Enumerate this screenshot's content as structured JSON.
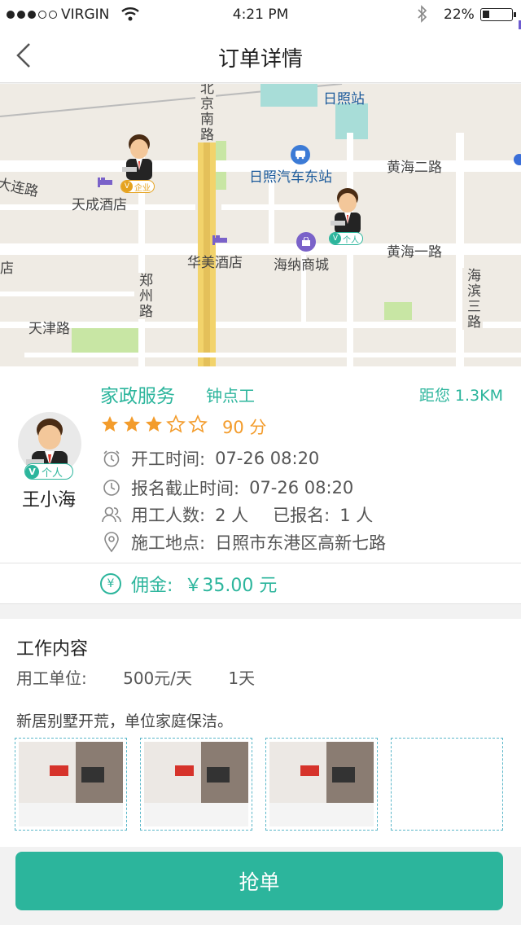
{
  "status_bar": {
    "carrier": "VIRGIN",
    "time": "4:21 PM",
    "battery": "22%",
    "battery_level": 0.22
  },
  "nav": {
    "title": "订单详情",
    "back_icon": "chevron-left-icon"
  },
  "map": {
    "labels": {
      "rizhao_station": "日照站",
      "bus_station": "日照汽车东站",
      "tiancheng_hotel": "天成酒店",
      "huamei_hotel": "华美酒店",
      "haina_mall": "海纳商城",
      "beijing_s_road": "北京南路",
      "huanghai2_road": "黄海二路",
      "huanghai1_road": "黄海一路",
      "dalian_road": "大连路",
      "zhengzhou_road": "郑州路",
      "tianjin_road": "天津路",
      "haibin3_road": "海滨三路",
      "left_fragment": "店"
    },
    "markers": [
      {
        "badge": "企业"
      },
      {
        "badge": "个人"
      }
    ]
  },
  "order": {
    "service": "家政服务",
    "job_type": "钟点工",
    "distance": "距您 1.3KM",
    "rating_stars": 3,
    "rating_max": 5,
    "score": "90 分",
    "worker": {
      "name": "王小海",
      "badge_v": "V",
      "badge_text": "个人"
    },
    "start_time_label": "开工时间:",
    "start_time": "07-26  08:20",
    "deadline_label": "报名截止时间:",
    "deadline": "07-26  08:20",
    "workers_label": "用工人数:",
    "workers_count": "2 人",
    "signed_label": "已报名:",
    "signed_count": "1 人",
    "location_label": "施工地点:",
    "location": "日照市东港区高新七路",
    "commission_label": "佣金:",
    "commission": "￥35.00 元"
  },
  "work": {
    "title": "工作内容",
    "unit_label": "用工单位:",
    "unit_price": "500元/天",
    "duration": "1天",
    "description": "新居别墅开荒，单位家庭保洁。",
    "photo_count": 3
  },
  "action": {
    "grab_label": "抢单"
  },
  "colors": {
    "accent": "#2cb59c",
    "star": "#f39c2c",
    "map_bg": "#efebe4",
    "road_main": "#f2d36b"
  }
}
